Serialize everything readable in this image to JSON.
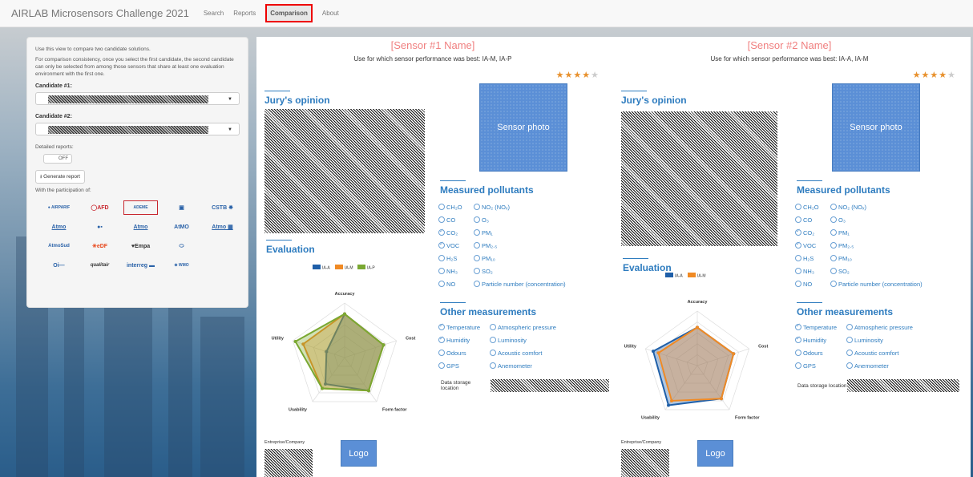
{
  "navbar": {
    "brand": "AIRLAB Microsensors Challenge 2021",
    "items": [
      "Search",
      "Reports",
      "Comparison",
      "About"
    ],
    "active": "Comparison"
  },
  "sidebar": {
    "intro1": "Use this view to compare two candidate solutions.",
    "intro2": "For comparison consistency, once you select the first candidate, the second candidate can only be selected from among those sensors that share at least one evaluation environment with the first one.",
    "candidate1_label": "Candidate #1:",
    "candidate2_label": "Candidate #2:",
    "detailed_label": "Detailed reports:",
    "toggle": "OFF",
    "generate_button": "Generate report",
    "participation": "With the participation of:",
    "logos": [
      "AIRPARIF",
      "AFD",
      "ADEME",
      "Airparif",
      "CSTB",
      "",
      "Atmo",
      "",
      "Atmo",
      "AtMO",
      "Atmo",
      "",
      "AtmoSud",
      "EDF",
      "Empa",
      "",
      "",
      "qualitair",
      "interreg",
      "WMO"
    ]
  },
  "labels": {
    "jury": "Jury's opinion",
    "evaluation": "Evaluation",
    "measured": "Measured pollutants",
    "other": "Other measurements",
    "storage": "Data storage location",
    "company": "Entreprise/Company",
    "photo": "Sensor photo",
    "logo": "Logo"
  },
  "pollutants": [
    [
      "CH₂O",
      "NO₂ (NOₓ)"
    ],
    [
      "CO",
      "O₃"
    ],
    [
      "CO₂",
      "PM₁"
    ],
    [
      "VOC",
      "PM₂.₅"
    ],
    [
      "H₂S",
      "PM₁₀"
    ],
    [
      "NH₃",
      "SO₂"
    ],
    [
      "NO",
      "Particle number (concentration)"
    ]
  ],
  "others": [
    [
      "Temperature",
      "Atmospheric pressure"
    ],
    [
      "Humidity",
      "Luminosity"
    ],
    [
      "Odours",
      "Acoustic comfort"
    ],
    [
      "GPS",
      "Anemometer"
    ]
  ],
  "sensors": [
    {
      "name": "[Sensor #1 Name]",
      "use": "Use for which sensor performance was best: IA-M, IA-P",
      "stars": 4,
      "checked_pollutants": [
        "CO₂",
        "VOC"
      ],
      "checked_others": [
        "Temperature",
        "Humidity"
      ]
    },
    {
      "name": "[Sensor #2 Name]",
      "use": "Use for which sensor performance was best: IA-A, IA-M",
      "stars": 4,
      "checked_pollutants": [
        "CO₂",
        "VOC"
      ],
      "checked_others": [
        "Temperature",
        "Humidity"
      ]
    }
  ],
  "colors": {
    "IA-A": "#1f5fa8",
    "IA-M": "#f08a24",
    "IA-P": "#7aa832",
    "accent": "#2e7cbf",
    "title": "#f08080"
  },
  "chart_data": [
    {
      "type": "radar",
      "axes": [
        "Accuracy",
        "Cost",
        "Form factor",
        "Usability",
        "Utility"
      ],
      "series": [
        {
          "name": "IA-A",
          "values": [
            0.8,
            0.75,
            0.75,
            0.6,
            0.35
          ]
        },
        {
          "name": "IA-M",
          "values": [
            0.8,
            0.75,
            0.75,
            0.7,
            0.8
          ]
        },
        {
          "name": "IA-P",
          "values": [
            0.8,
            0.75,
            0.75,
            0.7,
            0.95
          ]
        }
      ],
      "range": [
        0,
        1
      ],
      "legend": "top"
    },
    {
      "type": "radar",
      "axes": [
        "Accuracy",
        "Cost",
        "Form factor",
        "Usability",
        "Utility"
      ],
      "series": [
        {
          "name": "IA-A",
          "values": [
            0.7,
            0.7,
            0.75,
            0.9,
            0.85
          ]
        },
        {
          "name": "IA-M",
          "values": [
            0.7,
            0.7,
            0.75,
            0.8,
            0.75
          ]
        }
      ],
      "range": [
        0,
        1
      ],
      "legend": "top"
    }
  ]
}
